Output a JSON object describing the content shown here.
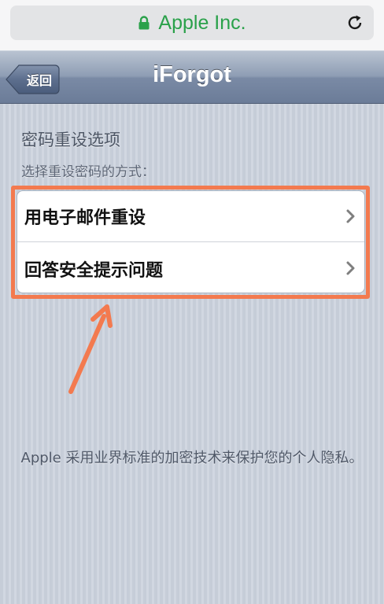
{
  "browser": {
    "url_text": "Apple Inc.",
    "url_color": "#2aa14a",
    "lock_icon": "lock-icon",
    "reload_icon": "reload-icon"
  },
  "nav": {
    "back_label": "返回",
    "title": "iForgot"
  },
  "content": {
    "section_title": "密码重设选项",
    "section_subtitle": "选择重设密码的方式：",
    "options": [
      {
        "label": "用电子邮件重设",
        "icon": "chevron-right-icon"
      },
      {
        "label": "回答安全提示问题",
        "icon": "chevron-right-icon"
      }
    ],
    "highlight_color": "#f37a4f",
    "privacy_note": "Apple 采用业界标准的加密技术来保护您的个人隐私。"
  }
}
